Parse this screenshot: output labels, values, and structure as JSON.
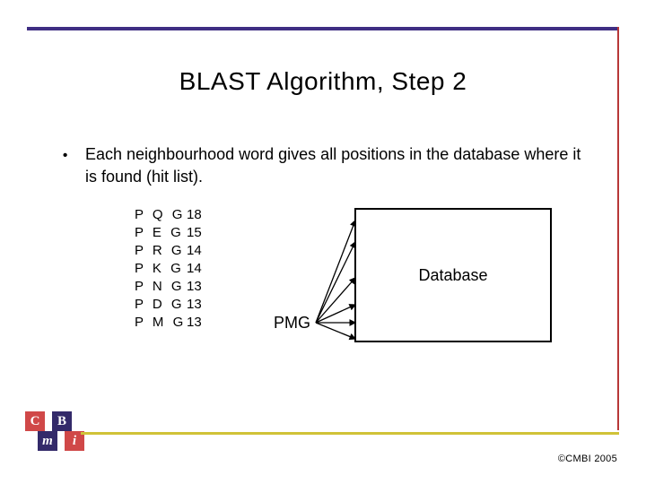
{
  "title": "BLAST Algorithm, Step 2",
  "bullet": "Each neighbourhood word gives all positions in the database where it is found (hit list).",
  "words": [
    {
      "triplet": "P Q G",
      "score": "18"
    },
    {
      "triplet": "P E G",
      "score": "15"
    },
    {
      "triplet": "P R G",
      "score": "14"
    },
    {
      "triplet": "P K G",
      "score": "14"
    },
    {
      "triplet": "P N G",
      "score": "13"
    },
    {
      "triplet": "P D G",
      "score": "13"
    },
    {
      "triplet": "P M G",
      "score": "13"
    }
  ],
  "pmg_label": "PMG",
  "database_label": "Database",
  "logo": {
    "c": "C",
    "m": "m",
    "b": "B",
    "i": "i"
  },
  "copyright": "©CMBI 2005"
}
